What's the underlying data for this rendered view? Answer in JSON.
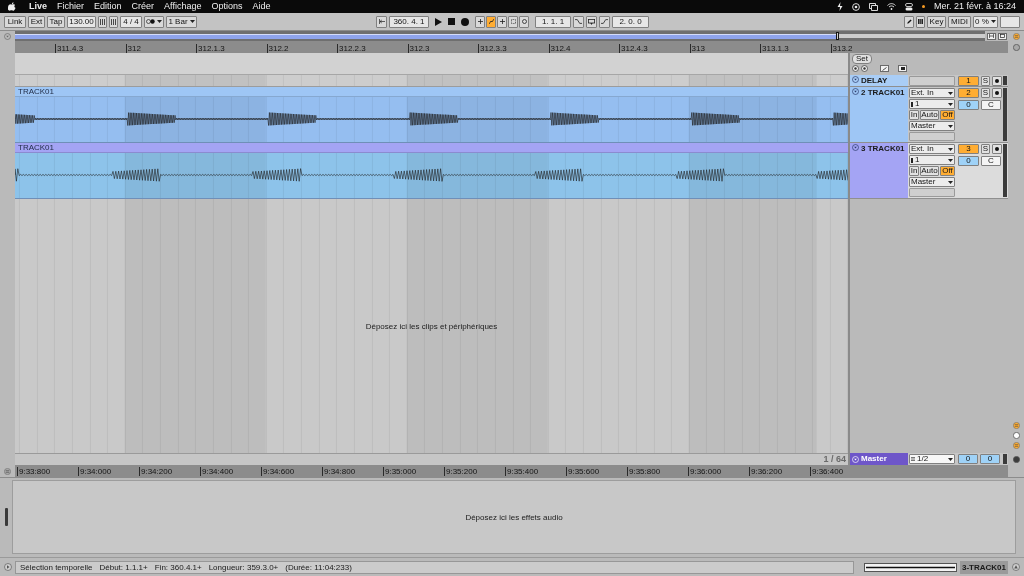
{
  "menu_bar": {
    "app": "Live",
    "menus": [
      "Fichier",
      "Edition",
      "Créer",
      "Affichage",
      "Options",
      "Aide"
    ],
    "clock": "Mer. 21 févr. à 16:24"
  },
  "toolbar": {
    "link": "Link",
    "ext": "Ext",
    "tap": "Tap",
    "tempo": "130.00",
    "signature": "4 / 4",
    "quantize": "1 Bar",
    "arrangement_position": "360. 4. 1",
    "automation_arm": {
      "on": true
    },
    "loop_start": "1. 1. 1",
    "loop_length": "2. 0. 0",
    "key": "Key",
    "midi": "MIDI",
    "cpu_load": "0 %"
  },
  "beat_ruler": {
    "labels": [
      "311.4.3",
      "312",
      "312.1.3",
      "312.2",
      "312.2.3",
      "312.3",
      "312.3.3",
      "312.4",
      "312.4.3",
      "313",
      "313.1.3",
      "313.2"
    ]
  },
  "set_button": "Set",
  "tracks": [
    {
      "kind": "folded",
      "name": "DELAY",
      "color": "#a9cdf6",
      "selected": false,
      "number": "1",
      "active": true,
      "solo": "S"
    },
    {
      "kind": "audio",
      "name": "2 TRACK01",
      "color": "#9ec6f5",
      "selected": false,
      "number": "2",
      "active": true,
      "solo": "S",
      "input_type": "Ext. In",
      "input_channel": "1",
      "monitor": [
        {
          "label": "In",
          "selected": false
        },
        {
          "label": "Auto",
          "selected": false
        },
        {
          "label": "Off",
          "selected": true
        }
      ],
      "output": "Master",
      "volume": "0",
      "pan": "C",
      "clip": {
        "name": "TRACK01",
        "color": "#95bef0"
      }
    },
    {
      "kind": "audio",
      "name": "3 TRACK01",
      "color": "#a4a4f4",
      "selected": true,
      "number": "3",
      "active": true,
      "solo": "S",
      "input_type": "Ext. In",
      "input_channel": "1",
      "monitor": [
        {
          "label": "In",
          "selected": false
        },
        {
          "label": "Auto",
          "selected": false
        },
        {
          "label": "Off",
          "selected": true
        }
      ],
      "output": "Master",
      "volume": "0",
      "pan": "C",
      "clip": {
        "name": "TRACK01",
        "color": "#8dc3ea"
      }
    }
  ],
  "drop_hint": "Déposez ici les clips et périphériques",
  "zoom_label": "1 / 64",
  "master": {
    "name": "Master",
    "output": "1/2",
    "fields": [
      "0",
      "0"
    ]
  },
  "time_ruler": {
    "labels": [
      "9:33:800",
      "9:34:000",
      "9:34:200",
      "9:34:400",
      "9:34:600",
      "9:34:800",
      "9:35:000",
      "9:35:200",
      "9:35:400",
      "9:35:600",
      "9:35:800",
      "9:36:000",
      "9:36:200",
      "9:36:400"
    ]
  },
  "device_hint": "Déposez ici les effets audio",
  "status_bar": {
    "items": [
      "Sélection temporelle",
      "Début: 1.1.1+",
      "Fin: 360.4.1+",
      "Longueur: 359.3.0+",
      "(Durée: 11:04:233)"
    ],
    "selected_track": "3-TRACK01"
  }
}
